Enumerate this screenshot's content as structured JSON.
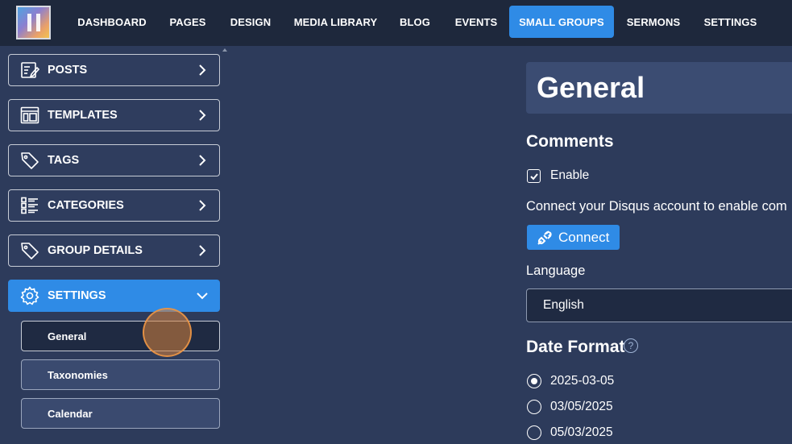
{
  "nav": {
    "items": [
      {
        "label": "DASHBOARD"
      },
      {
        "label": "PAGES"
      },
      {
        "label": "DESIGN"
      },
      {
        "label": "MEDIA LIBRARY"
      },
      {
        "label": "BLOG"
      },
      {
        "label": "EVENTS"
      },
      {
        "label": "SMALL GROUPS",
        "active": true
      },
      {
        "label": "SERMONS"
      },
      {
        "label": "SETTINGS"
      }
    ]
  },
  "sidebar": {
    "items": [
      {
        "label": "POSTS",
        "icon": "posts-icon"
      },
      {
        "label": "TEMPLATES",
        "icon": "templates-icon"
      },
      {
        "label": "TAGS",
        "icon": "tag-icon"
      },
      {
        "label": "CATEGORIES",
        "icon": "list-icon"
      },
      {
        "label": "GROUP DETAILS",
        "icon": "tag-icon"
      },
      {
        "label": "SETTINGS",
        "icon": "gear-icon",
        "active": true
      }
    ],
    "sub_items": [
      {
        "label": "General",
        "active": true
      },
      {
        "label": "Taxonomies"
      },
      {
        "label": "Calendar"
      }
    ]
  },
  "main": {
    "title": "General",
    "comments": {
      "heading": "Comments",
      "enable_label": "Enable",
      "enable_checked": true,
      "disqus_text": "Connect your Disqus account to enable com",
      "connect_label": "Connect"
    },
    "language": {
      "label": "Language",
      "value": "English"
    },
    "date_format": {
      "heading": "Date Format",
      "help_icon": "?",
      "options": [
        {
          "label": "2025-03-05",
          "selected": true
        },
        {
          "label": "03/05/2025",
          "selected": false
        },
        {
          "label": "05/03/2025",
          "selected": false
        }
      ]
    }
  },
  "colors": {
    "background": "#2d3b5b",
    "topbar": "#1e283c",
    "accent": "#2f8be6"
  }
}
